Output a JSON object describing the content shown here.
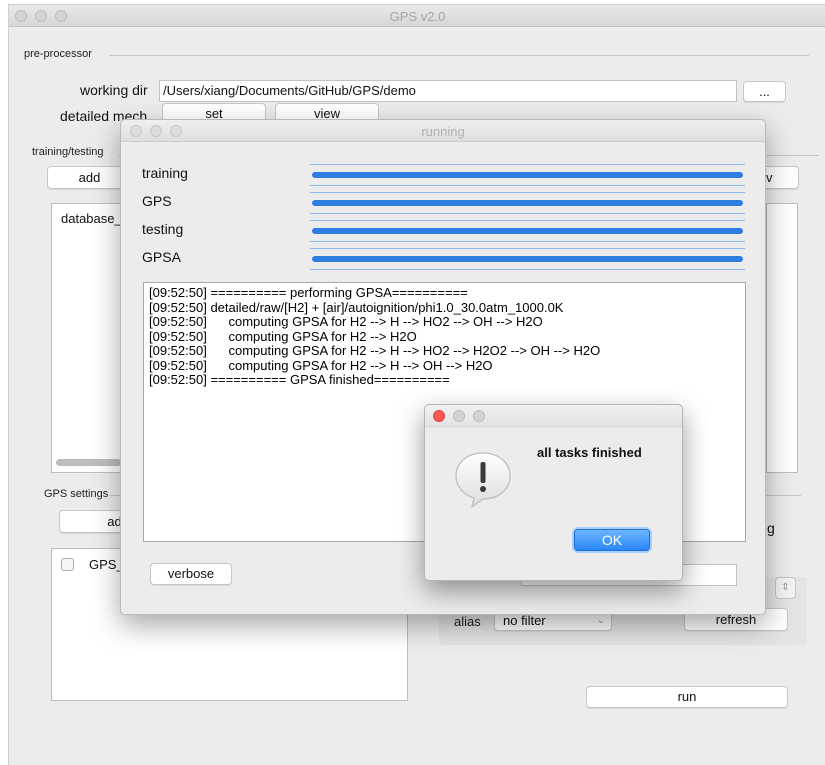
{
  "main_window": {
    "title": "GPS v2.0"
  },
  "preprocessor": {
    "group_label": "pre-processor",
    "working_dir_label": "working dir",
    "working_dir_value": "/Users/xiang/Documents/GitHub/GPS/demo",
    "browse_label": "...",
    "detailed_mech_label": "detailed mech",
    "set_label": "set",
    "view_label": "view"
  },
  "training": {
    "group_label": "training/testing",
    "add_label": "add",
    "view_label": "v",
    "list_items": [
      "database_"
    ]
  },
  "gps_settings": {
    "group_label": "GPS settings",
    "add_label": "add",
    "list_items": [
      "GPS_"
    ],
    "right_label": "g",
    "alias_label": "alias",
    "alias_value": "no filter",
    "refresh_label": "refresh",
    "run_label": "run"
  },
  "running_window": {
    "title": "running",
    "progress": [
      {
        "label": "training",
        "value": 1.0
      },
      {
        "label": "GPS",
        "value": 1.0
      },
      {
        "label": "testing",
        "value": 1.0
      },
      {
        "label": "GPSA",
        "value": 1.0
      }
    ],
    "log_lines": [
      "[09:52:50] ========== performing GPSA==========",
      "[09:52:50] detailed/raw/[H2] + [air]/autoignition/phi1.0_30.0atm_1000.0K",
      "[09:52:50]      computing GPSA for H2 --> H --> HO2 --> OH --> H2O",
      "[09:52:50]      computing GPSA for H2 --> H2O",
      "[09:52:50]      computing GPSA for H2 --> H --> HO2 --> H2O2 --> OH --> H2O",
      "[09:52:50]      computing GPSA for H2 --> H --> OH --> H2O",
      "[09:52:50] ========== GPSA finished=========="
    ],
    "verbose_label": "verbose"
  },
  "dialog": {
    "message": "all tasks finished",
    "icon": "exclamation-speech-icon",
    "ok_label": "OK"
  },
  "colors": {
    "progress_fill": "#2f7de1",
    "ok_button": "#2a86f6",
    "close_light": "#fc5753"
  }
}
